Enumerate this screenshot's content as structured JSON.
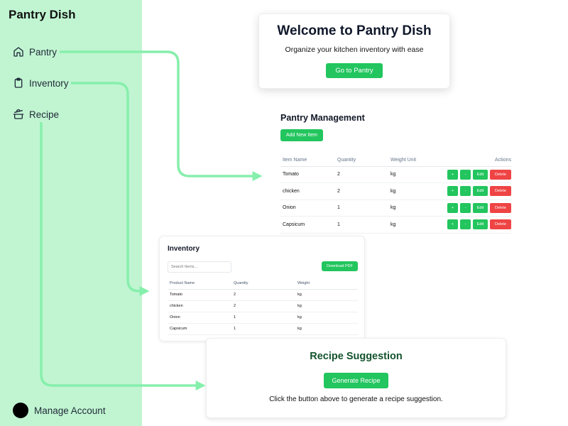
{
  "sidebar": {
    "brand": "Pantry Dish",
    "items": [
      {
        "label": "Pantry",
        "icon": "home-icon"
      },
      {
        "label": "Inventory",
        "icon": "clipboard-icon"
      },
      {
        "label": "Recipe",
        "icon": "cooking-pot-icon"
      }
    ],
    "account_label": "Manage Account",
    "background": "#c1f5d2"
  },
  "welcome": {
    "title": "Welcome to Pantry Dish",
    "subtitle": "Organize your kitchen inventory with ease",
    "button": "Go to Pantry"
  },
  "pantry": {
    "title": "Pantry Management",
    "add_button": "Add New Item",
    "columns": [
      "Item Name",
      "Quantity",
      "Weight Unit",
      "Actions"
    ],
    "rows": [
      {
        "name": "Tomato",
        "qty": "2",
        "unit": "kg"
      },
      {
        "name": "chicken",
        "qty": "2",
        "unit": "kg"
      },
      {
        "name": "Onion",
        "qty": "1",
        "unit": "kg"
      },
      {
        "name": "Capsicum",
        "qty": "1",
        "unit": "kg"
      }
    ],
    "action_labels": {
      "plus": "+",
      "minus": "-",
      "edit": "Edit",
      "delete": "Delete"
    }
  },
  "inventory": {
    "title": "Inventory",
    "search_placeholder": "Search Items...",
    "download_button": "Download PDF",
    "columns": [
      "Product Name",
      "Quantity",
      "Weight"
    ],
    "rows": [
      {
        "name": "Tomato",
        "qty": "2",
        "unit": "kg"
      },
      {
        "name": "chicken",
        "qty": "2",
        "unit": "kg"
      },
      {
        "name": "Onion",
        "qty": "1",
        "unit": "kg"
      },
      {
        "name": "Capsicum",
        "qty": "1",
        "unit": "kg"
      }
    ]
  },
  "recipe": {
    "title": "Recipe Suggestion",
    "button": "Generate Recipe",
    "hint": "Click the button above to generate a recipe suggestion."
  },
  "colors": {
    "accent": "#22c55e",
    "danger": "#ef4444",
    "connector": "#86efac"
  }
}
